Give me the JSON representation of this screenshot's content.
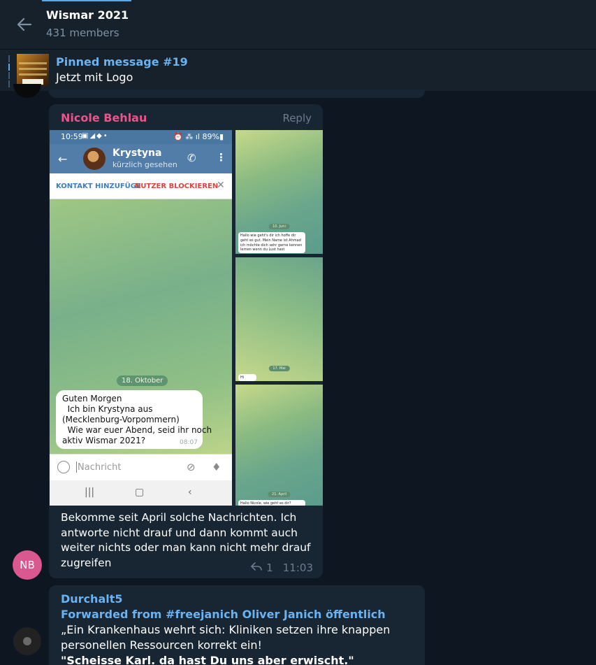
{
  "header": {
    "title": "Wismar 2021",
    "subtitle": "431 members"
  },
  "pinned": {
    "title": "Pinned message #19",
    "text": "Jetzt mit Logo"
  },
  "message1": {
    "sender": "Nicole Behlau",
    "reply_label": "Reply",
    "caption": "Bekomme seit April solche Nachrichten. Ich antworte nicht drauf und dann kommt auch weiter nichts oder man kann nicht mehr drauf zugreifen",
    "replies": "1",
    "time": "11:03",
    "avatar_initials": "NB",
    "screenshot": {
      "status_time": "10:59",
      "battery": "89%",
      "contact_name": "Krystyna",
      "contact_status": "kürzlich gesehen",
      "action_add": "KONTAKT HINZUFÜGE",
      "action_block": "NUTZER BLOCKIEREN",
      "date_label": "18. Oktober",
      "message_text": "Guten Morgen\n  Ich bin Krystyna aus\n(Mecklenburg-Vorpommern)\n  Wie war euer Abend, seid ihr noch\naktiv Wismar 2021?",
      "message_time": "08:07",
      "input_placeholder": "Nachricht"
    },
    "side1": {
      "date": "10. Juni",
      "text": "Hallo wie geht's dir ich hoffe dir geht es gut. Mein Name ist Ahmad ich möchte dich sehr gerne kennen lernen wenn du Lust hast"
    },
    "side2": {
      "date": "17. Mai",
      "text": "Hi"
    },
    "side3": {
      "date": "21. April",
      "text": "Hallo Nicole, wie geht es dir?"
    }
  },
  "message2": {
    "sender": "Durchalt5",
    "forwarded": "Forwarded from #freejanich Oliver Janich öffentlich",
    "line1": "„Ein Krankenhaus wehrt sich: Kliniken setzen ihre knappen",
    "line2": "personellen Ressourcen korrekt ein!",
    "line3": "\"Scheisse Karl. da hast Du uns aber erwischt.\""
  },
  "colors": {
    "background": "#0e1621",
    "panel": "#17212b",
    "bubble": "#182533",
    "accent": "#6ab3f3",
    "sender_pink": "#e5568b"
  }
}
